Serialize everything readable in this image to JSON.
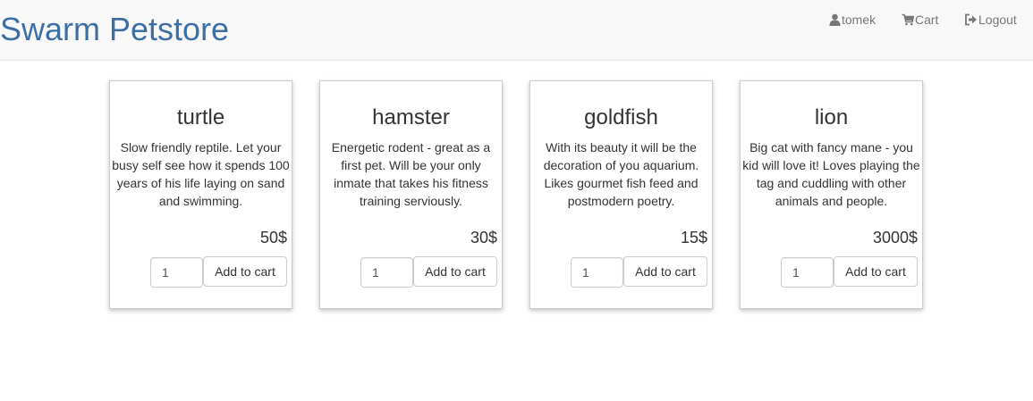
{
  "header": {
    "brand": "Swarm Petstore",
    "nav": {
      "user": {
        "label": "tomek",
        "icon": "user-icon"
      },
      "cart": {
        "label": "Cart",
        "icon": "cart-icon"
      },
      "logout": {
        "label": "Logout",
        "icon": "logout-icon"
      }
    }
  },
  "colors": {
    "brand": "#3d6fa5",
    "navbar_bg": "#f8f8f8",
    "nav_text": "#777777"
  },
  "products": [
    {
      "name": "turtle",
      "description": "Slow friendly reptile. Let your busy self see how it spends 100 years of his life laying on sand and swimming.",
      "price": "50$",
      "quantity": "1",
      "button_label": "Add to cart"
    },
    {
      "name": "hamster",
      "description": "Energetic rodent - great as a first pet. Will be your only inmate that takes his fitness training serviously.",
      "price": "30$",
      "quantity": "1",
      "button_label": "Add to cart"
    },
    {
      "name": "goldfish",
      "description": "With its beauty it will be the decoration of you aquarium. Likes gourmet fish feed and postmodern poetry.",
      "price": "15$",
      "quantity": "1",
      "button_label": "Add to cart"
    },
    {
      "name": "lion",
      "description": "Big cat with fancy mane - you kid will love it! Loves playing the tag and cuddling with other animals and people.",
      "price": "3000$",
      "quantity": "1",
      "button_label": "Add to cart"
    }
  ]
}
